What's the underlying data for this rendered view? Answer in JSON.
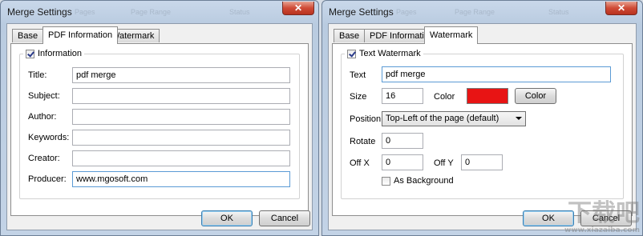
{
  "left": {
    "title": "Merge Settings",
    "ghost_labels": [
      "Pages",
      "Page Range",
      "Status"
    ],
    "close_glyph": "✕",
    "tabs": [
      "Base",
      "PDF Information",
      "Watermark"
    ],
    "group_label": "Information",
    "group_checked": true,
    "fields": [
      {
        "label": "Title:",
        "value": "pdf merge"
      },
      {
        "label": "Subject:",
        "value": ""
      },
      {
        "label": "Author:",
        "value": ""
      },
      {
        "label": "Keywords:",
        "value": ""
      },
      {
        "label": "Creator:",
        "value": ""
      },
      {
        "label": "Producer:",
        "value": "www.mgosoft.com"
      }
    ],
    "ok": "OK",
    "cancel": "Cancel"
  },
  "right": {
    "title": "Merge Settings",
    "ghost_labels": [
      "Pages",
      "Page Range",
      "Status"
    ],
    "close_glyph": "✕",
    "tabs": [
      "Base",
      "PDF Information",
      "Watermark"
    ],
    "group_label": "Text Watermark",
    "group_checked": true,
    "text_label": "Text",
    "text_value": "pdf merge",
    "size_label": "Size",
    "size_value": "16",
    "color_label": "Color",
    "color_value": "#e81414",
    "color_button": "Color",
    "position_label": "Position",
    "position_value": "Top-Left of the page (default)",
    "rotate_label": "Rotate",
    "rotate_value": "0",
    "offx_label": "Off X",
    "offx_value": "0",
    "offy_label": "Off Y",
    "offy_value": "0",
    "background_label": "As Background",
    "background_checked": false,
    "ok": "OK",
    "cancel": "Cancel"
  },
  "watermark": {
    "main": "下载吧",
    "sub": "www.xiazaiba.com"
  }
}
